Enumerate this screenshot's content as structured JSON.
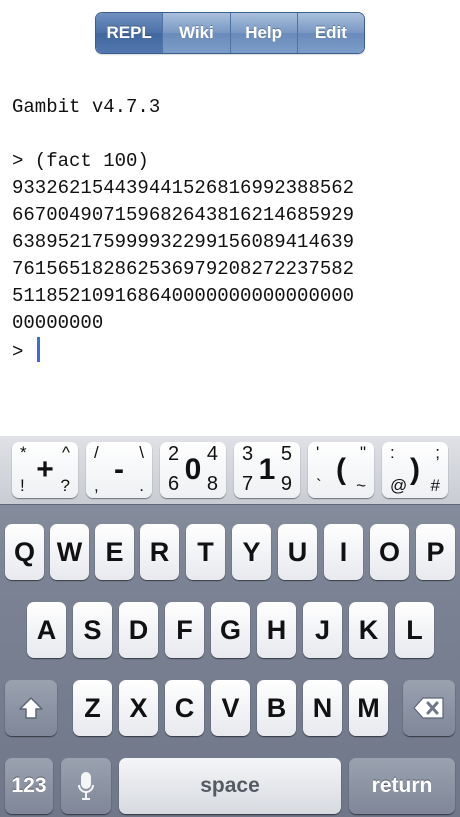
{
  "tabs": [
    {
      "label": "REPL"
    },
    {
      "label": "Wiki"
    },
    {
      "label": "Help"
    },
    {
      "label": "Edit"
    }
  ],
  "console": {
    "version": "Gambit v4.7.3",
    "input": "> (fact 100)",
    "output": [
      "933262154439441526816992388562",
      "667004907159682643816214685929",
      "638952175999932299156089414639",
      "761565182862536979208272237582",
      "511852109168640000000000000000",
      "00000000"
    ],
    "prompt": ">"
  },
  "symbol_keys": [
    {
      "tl": "*",
      "tr": "^",
      "bl": "!",
      "br": "?",
      "center": "+"
    },
    {
      "tl": "/",
      "tr": "\\",
      "bl": ",",
      "br": ".",
      "center": "-"
    },
    {
      "tl": "2",
      "tr": "4",
      "bl": "6",
      "br": "8",
      "center": "0"
    },
    {
      "tl": "3",
      "tr": "5",
      "bl": "7",
      "br": "9",
      "center": "1"
    },
    {
      "tl": "'",
      "tr": "\"",
      "bl": "`",
      "br": "~",
      "center": "("
    },
    {
      "tl": ":",
      "tr": ";",
      "bl": "@",
      "br": "#",
      "center": ")"
    }
  ],
  "keyboard": {
    "row1": [
      "Q",
      "W",
      "E",
      "R",
      "T",
      "Y",
      "U",
      "I",
      "O",
      "P"
    ],
    "row2": [
      "A",
      "S",
      "D",
      "F",
      "G",
      "H",
      "J",
      "K",
      "L"
    ],
    "row3": [
      "Z",
      "X",
      "C",
      "V",
      "B",
      "N",
      "M"
    ],
    "numbers_label": "123",
    "space_label": "space",
    "return_label": "return"
  },
  "icons": {
    "shift": "shift-arrow-icon",
    "backspace": "backspace-icon",
    "microphone": "microphone-icon"
  },
  "colors": {
    "tab_accent": "#6a8bba",
    "cursor": "#3b6be0",
    "keyboard_bg": "#7a8293"
  }
}
